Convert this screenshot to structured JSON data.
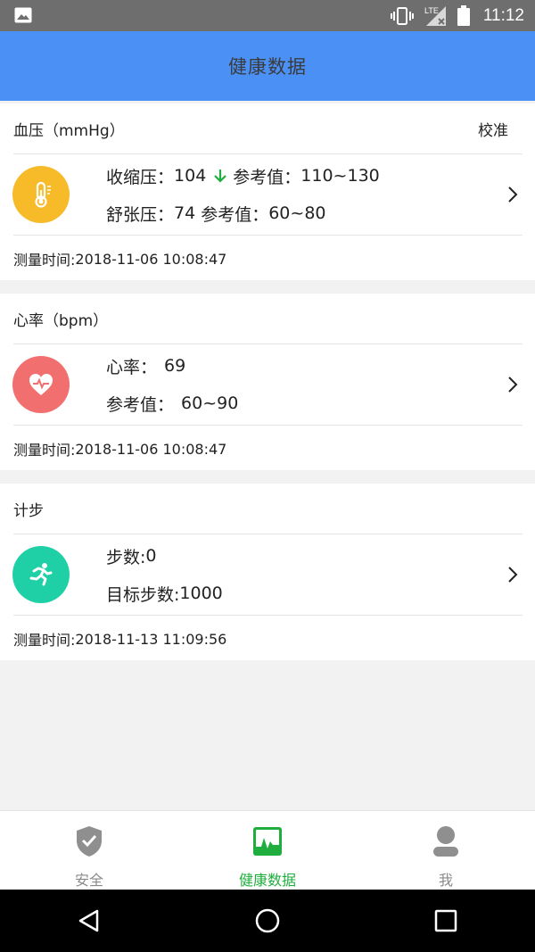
{
  "status_bar": {
    "time": "11:12",
    "network": "LTE",
    "icons": [
      "gallery-icon",
      "vibrate-icon",
      "signal-icon",
      "battery-icon"
    ]
  },
  "app_bar": {
    "title": "健康数据"
  },
  "blood_pressure": {
    "header": "血压（mmHg）",
    "action": "校准",
    "systolic_label": "收缩压：",
    "systolic_value": "104",
    "systolic_ref_label": "参考值：",
    "systolic_ref": "110~130",
    "diastolic_label": "舒张压：",
    "diastolic_value": "74",
    "diastolic_ref_label": "参考值：",
    "diastolic_ref": "60~80",
    "time_label": "测量时间:",
    "time": "2018-11-06 10:08:47",
    "icon": "thermometer-icon",
    "color": "#f7bb2a"
  },
  "heart_rate": {
    "header": "心率（bpm）",
    "rate_label": "心率：",
    "rate_value": "69",
    "ref_label": "参考值：",
    "ref_value": "60~90",
    "time_label": "测量时间:",
    "time": "2018-11-06 10:08:47",
    "icon": "heart-pulse-icon",
    "color": "#f26f6f"
  },
  "steps": {
    "header": "计步",
    "steps_label": "步数:",
    "steps_value": "0",
    "target_label": "目标步数:",
    "target_value": "1000",
    "time_label": "测量时间:",
    "time": "2018-11-13 11:09:56",
    "icon": "running-icon",
    "color": "#1fd0a6"
  },
  "tabs": [
    {
      "label": "安全",
      "icon": "shield-check-icon",
      "active": false
    },
    {
      "label": "健康数据",
      "icon": "health-chart-icon",
      "active": true
    },
    {
      "label": "我",
      "icon": "user-icon",
      "active": false
    }
  ],
  "colors": {
    "app_bar": "#4a90f5",
    "active_tab": "#1fae3e",
    "down_arrow": "#1fae3e"
  }
}
